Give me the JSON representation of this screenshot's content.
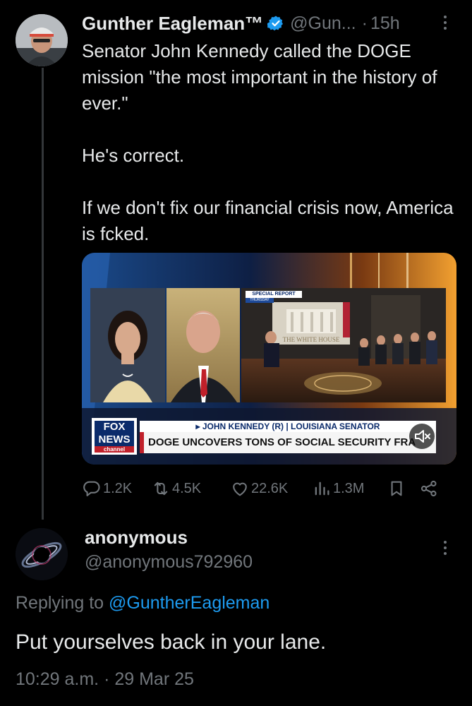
{
  "tweet": {
    "author_name": "Gunther Eagleman™",
    "handle": "@Gun...",
    "separator": "·",
    "time": "15h",
    "paragraphs": [
      "Senator John Kennedy called the DOGE mission \"the most important in the history of ever.\"",
      "He's correct.",
      "If we don't fix our financial crisis now, America is fcked."
    ],
    "media": {
      "special_report": "SPECIAL REPORT",
      "special_day": "THURSDAY",
      "backdrop_text": "THE WHITE HOUSE",
      "lower_third_name": "▸ JOHN KENNEDY (R) | LOUISIANA SENATOR",
      "headline": "DOGE UNCOVERS TONS OF SOCIAL SECURITY FRAUD",
      "logo_line1": "FOX",
      "logo_line2": "NEWS",
      "logo_line3": "channel"
    },
    "stats": {
      "replies": "1.2K",
      "reposts": "4.5K",
      "likes": "22.6K",
      "views": "1.3M"
    }
  },
  "reply": {
    "author_name": "anonymous",
    "handle": "@anonymous792960",
    "replying_prefix": "Replying to ",
    "replying_to": "@GuntherEagleman",
    "text": "Put yourselves back in your lane.",
    "timestamp": "10:29 a.m. · 29 Mar 25"
  },
  "colors": {
    "background": "#000000",
    "text": "#e7e9ea",
    "muted": "#71767b",
    "link": "#1d9bf0",
    "verified": "#1d9bf0"
  }
}
